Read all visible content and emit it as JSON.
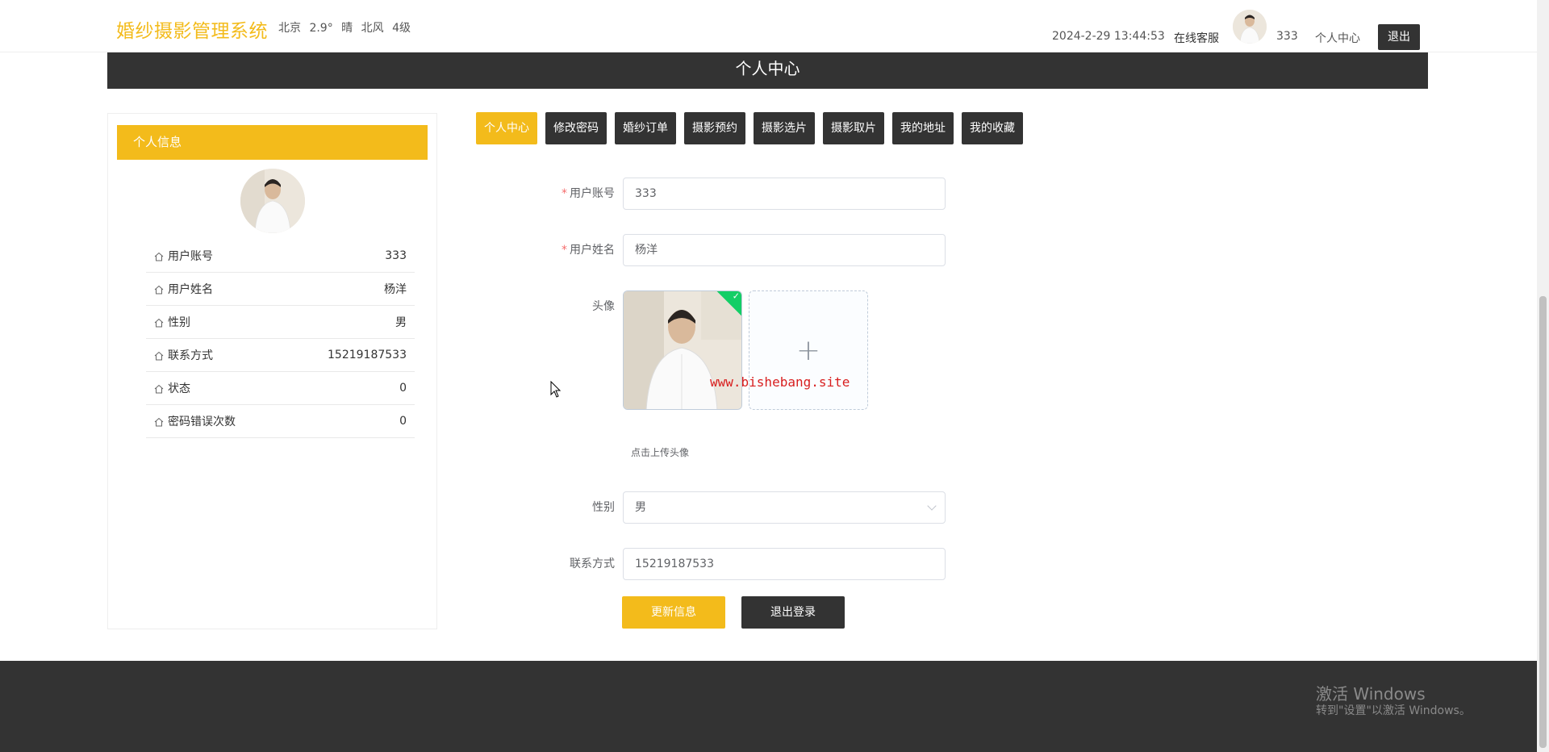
{
  "header": {
    "logo": "婚纱摄影管理系统",
    "weather": {
      "city": "北京",
      "temp": "2.9°",
      "condition": "晴",
      "wind": "北风",
      "level": "4级"
    },
    "datetime": "2024-2-29 13:44:53",
    "service": "在线客服",
    "username": "333",
    "center": "个人中心",
    "logout": "退出"
  },
  "title": "个人中心",
  "left_panel": {
    "header": "个人信息",
    "rows": [
      {
        "label": "用户账号",
        "value": "333"
      },
      {
        "label": "用户姓名",
        "value": "杨洋"
      },
      {
        "label": "性别",
        "value": "男"
      },
      {
        "label": "联系方式",
        "value": "15219187533"
      },
      {
        "label": "状态",
        "value": "0"
      },
      {
        "label": "密码错误次数",
        "value": "0"
      }
    ]
  },
  "tabs": [
    "个人中心",
    "修改密码",
    "婚纱订单",
    "摄影预约",
    "摄影选片",
    "摄影取片",
    "我的地址",
    "我的收藏"
  ],
  "form": {
    "account_label": "用户账号",
    "account_value": "333",
    "name_label": "用户姓名",
    "name_value": "杨洋",
    "avatar_label": "头像",
    "upload_tip": "点击上传头像",
    "gender_label": "性别",
    "gender_value": "男",
    "phone_label": "联系方式",
    "phone_value": "15219187533",
    "update_button": "更新信息",
    "logout_button": "退出登录"
  },
  "watermark": "www.bishebang.site",
  "windows_activation": {
    "title": "激活 Windows",
    "subtitle": "转到\"设置\"以激活 Windows。"
  },
  "colors": {
    "accent": "#f3bb1b",
    "dark": "#333333"
  }
}
